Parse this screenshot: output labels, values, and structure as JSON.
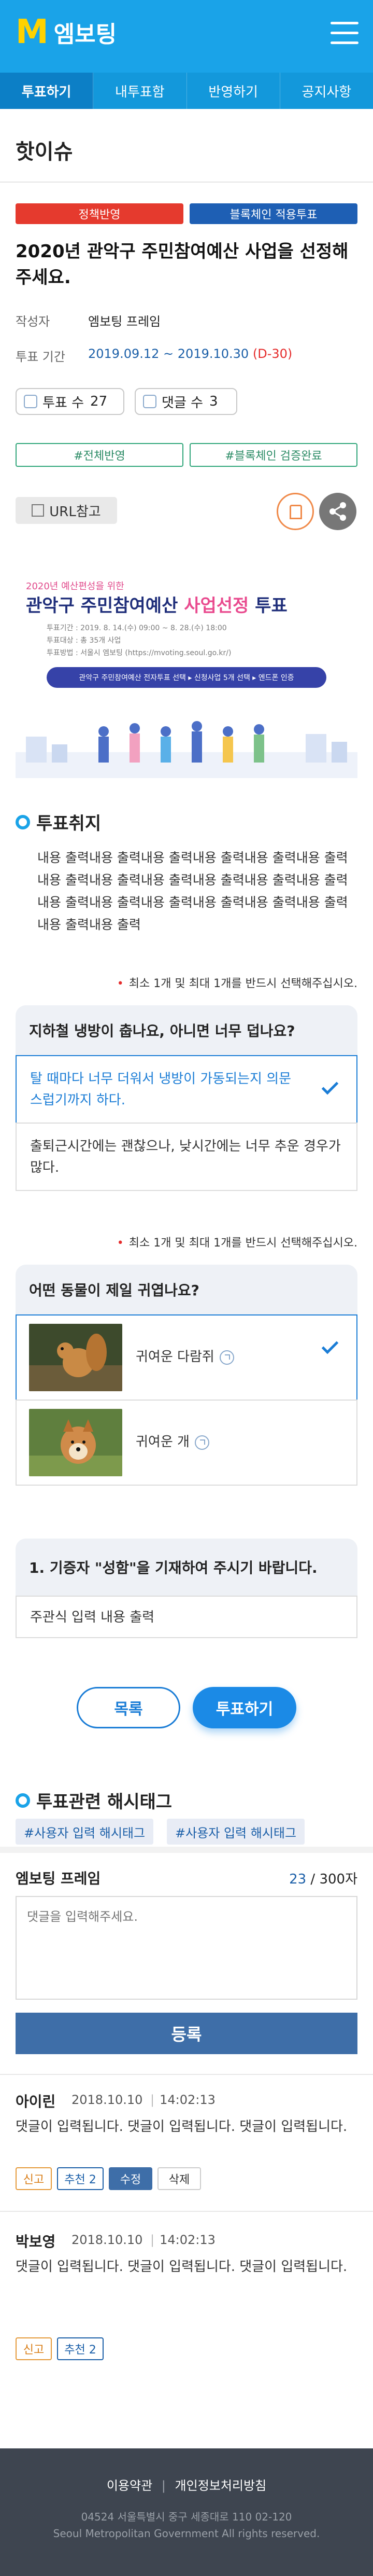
{
  "app": {
    "logo_mark": "M",
    "logo_text": "엠보팅"
  },
  "tabs": [
    {
      "label": "투표하기",
      "active": true
    },
    {
      "label": "내투표함"
    },
    {
      "label": "반영하기"
    },
    {
      "label": "공지사항"
    }
  ],
  "page_title": "핫이슈",
  "badges": {
    "reflect": "정책반영",
    "blockchain": "블록체인 적용투표"
  },
  "vote": {
    "title": "2020년 관악구 주민참여예산 사업을 선정해주세요.",
    "author_label": "작성자",
    "author": "엠보팅 프레임",
    "period_label": "투표 기간",
    "period": "2019.09.12 ~ 2019.10.30",
    "dday": "(D-30)",
    "vote_count_label": "투표 수",
    "vote_count": "27",
    "comment_count_label": "댓글 수",
    "comment_count": "3",
    "tag_all": "#전체반영",
    "tag_verified": "#블록체인 검증완료",
    "url_button": "URL참고"
  },
  "poster": {
    "sub": "2020년 예산편성을 위한",
    "title_a": "관악구 주민참여예산",
    "title_b": "사업선정",
    "title_c": "투표",
    "info1": "투표기간 : 2019. 8. 14.(수) 09:00 ~ 8. 28.(수) 18:00",
    "info2": "투표대상 : 총 35개 사업",
    "info3": "투표방법 : 서울시 엠보팅 (https://mvoting.seoul.go.kr/)",
    "bar": "관악구 주민참여예산 전자투표 선택 ▸ 신청사업 5개 선택 ▸ 엔드폰 인증"
  },
  "purpose": {
    "heading": "투표취지",
    "text": "내용 출력내용 출력내용 출력내용 출력내용 출력내용 출력내용 출력내용 출력내용 출력내용 출력내용 출력내용 출력내용 출력내용 출력내용 출력내용 출력내용 출력내용 출력내용 출력내용 출력"
  },
  "questions": [
    {
      "notice": "최소 1개 및 최대 1개를 반드시 선택해주십시오.",
      "title": "지하철 냉방이 춥나요, 아니면 너무 덥나요?",
      "options": [
        {
          "label": "탈 때마다 너무 더워서 냉방이 가동되는지 의문스럽기까지 하다.",
          "selected": true
        },
        {
          "label": "출퇴근시간에는 괜찮으나, 낮시간에는 너무 추운 경우가 많다.",
          "selected": false
        }
      ]
    },
    {
      "notice": "최소 1개 및 최대 1개를 반드시 선택해주십시오.",
      "title": "어떤 동물이 제일 귀엽나요?",
      "options": [
        {
          "label": "귀여운 다람쥐",
          "selected": true,
          "image": "squirrel-photo"
        },
        {
          "label": "귀여운 개",
          "selected": false,
          "image": "dog-photo"
        }
      ]
    },
    {
      "title": "1. 기증자 \"성함\"을 기재하여 주시기 바랍니다.",
      "answer": "주관식 입력 내용 출력"
    }
  ],
  "actions": {
    "list": "목록",
    "vote": "투표하기"
  },
  "hashtags": {
    "heading": "투표관련 해시태그",
    "items": [
      "#사용자 입력 해시태그",
      "#사용자 입력 해시태그"
    ]
  },
  "comment_form": {
    "name": "엠보팅 프레임",
    "count": "23",
    "max": " / 300자",
    "placeholder": "댓글을 입력해주세요.",
    "submit": "등록"
  },
  "comments": [
    {
      "author": "아이린",
      "date": "2018.10.10",
      "time": "14:02:13",
      "text": "댓글이 입력됩니다. 댓글이 입력됩니다. 댓글이 입력됩니다.",
      "report": "신고",
      "recommend": "추천 2",
      "edit": "수정",
      "delete": "삭제"
    },
    {
      "author": "박보영",
      "date": "2018.10.10",
      "time": "14:02:13",
      "text": "댓글이 입력됩니다. 댓글이 입력됩니다. 댓글이 입력됩니다.",
      "report": "신고",
      "recommend": "추천 2"
    }
  ],
  "footer": {
    "terms": "이용약관",
    "sep": "|",
    "privacy": "개인정보처리방침",
    "address": "04524 서울특별시 중구 세종대로 110    02-120",
    "copyright": "Seoul Metropolitan Government All rights reserved."
  },
  "colors": {
    "header": "#1aa3e8",
    "accent": "#1b7dd6",
    "red_badge": "#e53a2e",
    "blue_badge": "#1e5fb4",
    "green_tag": "#31a67a"
  }
}
